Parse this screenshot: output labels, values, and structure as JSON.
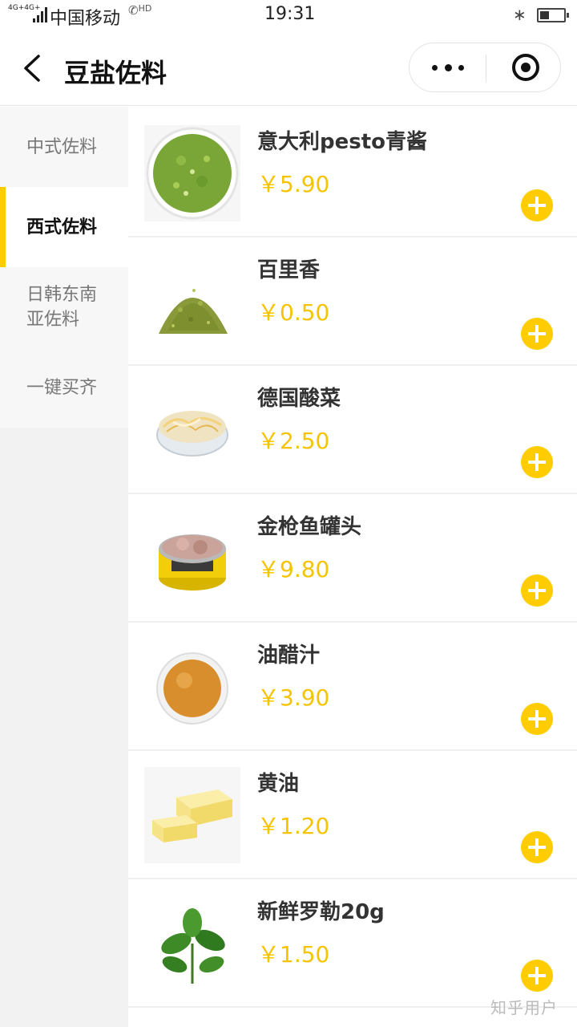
{
  "status_bar": {
    "network": "4G+4G+",
    "carrier": "中国移动",
    "hd": "HD",
    "time": "19:31",
    "battery_level": 0.4
  },
  "nav": {
    "title": "豆盐佐料"
  },
  "sidebar": {
    "items": [
      {
        "label": "中式佐料",
        "active": false
      },
      {
        "label": "西式佐料",
        "active": true
      },
      {
        "label": "日韩东南亚佐料",
        "active": false
      },
      {
        "label": "一键买齐",
        "active": false
      }
    ]
  },
  "products": [
    {
      "name": "意大利pesto青酱",
      "price": "￥5.90",
      "icon": "pesto-sauce-image"
    },
    {
      "name": "百里香",
      "price": "￥0.50",
      "icon": "thyme-image"
    },
    {
      "name": "德国酸菜",
      "price": "￥2.50",
      "icon": "sauerkraut-image"
    },
    {
      "name": "金枪鱼罐头",
      "price": "￥9.80",
      "icon": "canned-tuna-image"
    },
    {
      "name": "油醋汁",
      "price": "￥3.90",
      "icon": "vinaigrette-image"
    },
    {
      "name": "黄油",
      "price": "￥1.20",
      "icon": "butter-image"
    },
    {
      "name": "新鲜罗勒20g",
      "price": "￥1.50",
      "icon": "basil-image"
    }
  ],
  "watermark": "知乎用户",
  "colors": {
    "accent": "#ffcc00",
    "price": "#f5c400",
    "sidebar_bg": "#f2f2f2"
  }
}
